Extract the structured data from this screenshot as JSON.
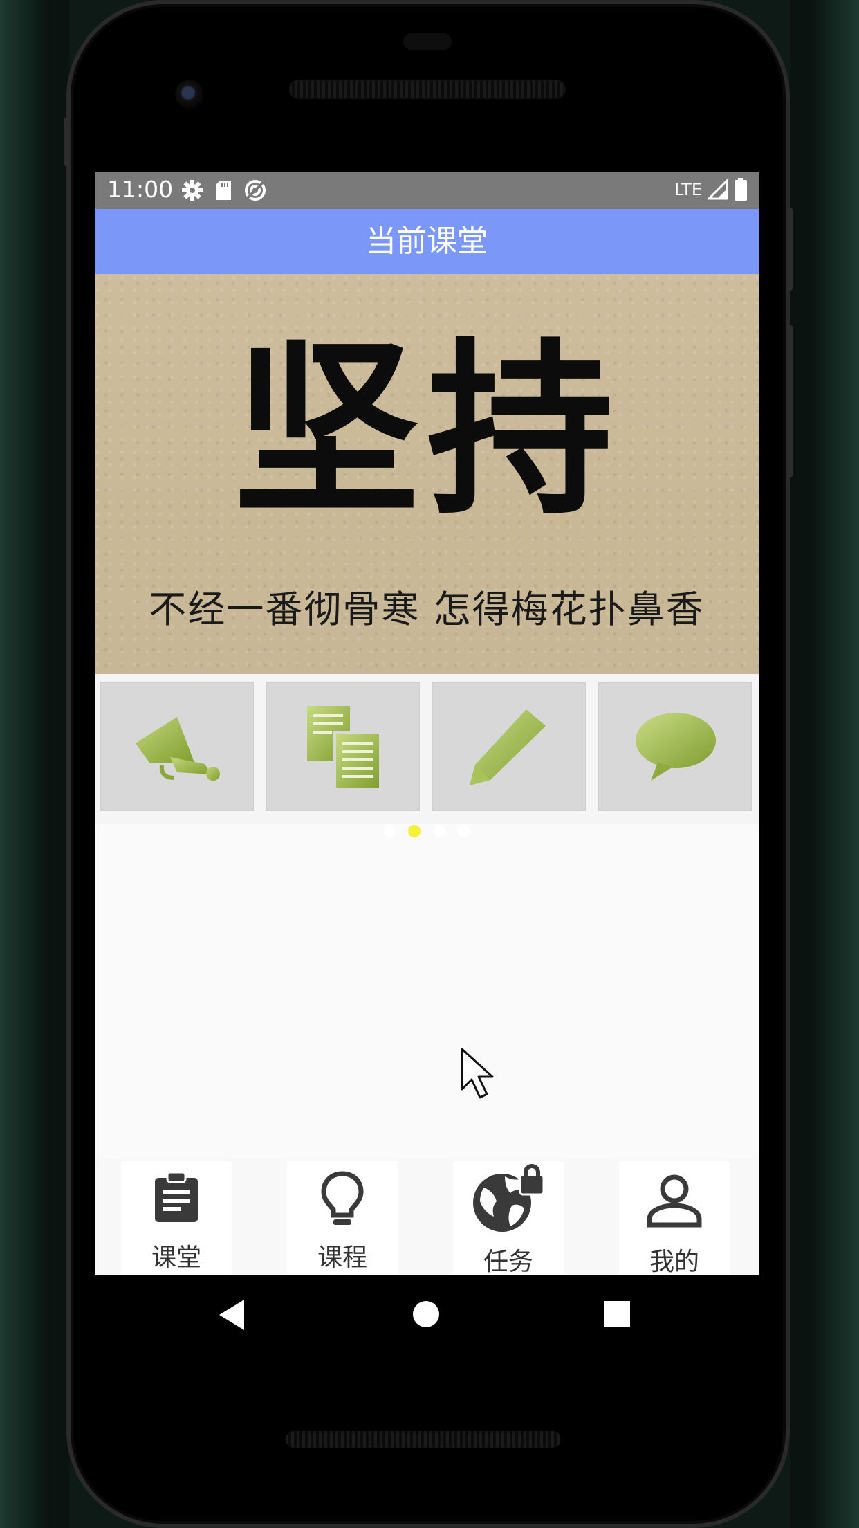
{
  "status_bar": {
    "time": "11:00",
    "network": "LTE",
    "icons": [
      "settings-icon",
      "sd-card-icon",
      "sync-icon",
      "signal-icon",
      "battery-icon"
    ]
  },
  "header": {
    "title": "当前课堂"
  },
  "banner": {
    "main_text": "坚持",
    "sub_text": "不经一番彻骨寒 怎得梅花扑鼻香",
    "page_count": 4,
    "active_page": 2
  },
  "quick_actions": {
    "items": [
      {
        "icon": "megaphone-icon"
      },
      {
        "icon": "documents-icon"
      },
      {
        "icon": "pencil-icon"
      },
      {
        "icon": "chat-bubble-icon"
      }
    ],
    "icon_color": "#9dbb45"
  },
  "bottom_nav": {
    "items": [
      {
        "label": "课堂",
        "icon": "clipboard-icon"
      },
      {
        "label": "课程",
        "icon": "lightbulb-icon"
      },
      {
        "label": "任务",
        "icon": "globe-lock-icon"
      },
      {
        "label": "我的",
        "icon": "person-icon"
      }
    ]
  },
  "colors": {
    "title_bar": "#7b97f7",
    "status_bar": "#7a7a7a",
    "active_dot": "#f5f03a"
  }
}
